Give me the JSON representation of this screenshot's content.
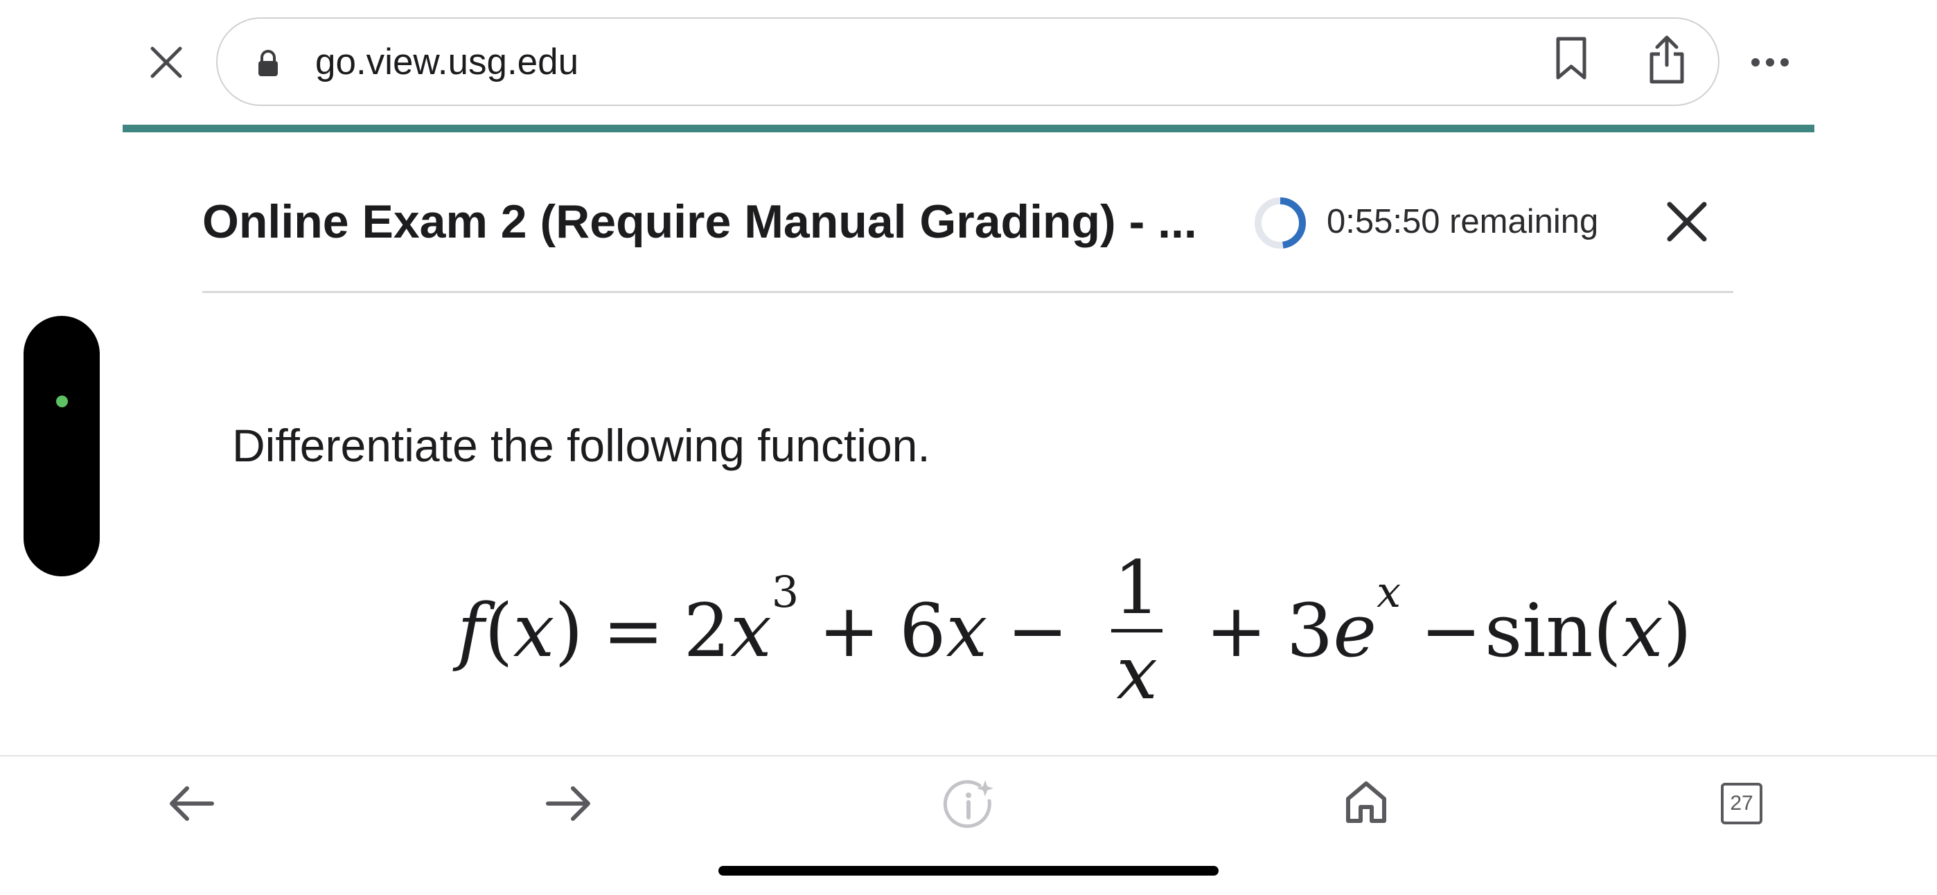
{
  "browser": {
    "url": "go.view.usg.edu",
    "icons": [
      "close-icon",
      "lock-icon",
      "bookmark-icon",
      "share-icon",
      "more-icon"
    ]
  },
  "exam": {
    "title": "Online Exam 2 (Require Manual Grading) - ...",
    "timer_text": "0:55:50 remaining",
    "timer_fraction_remaining": 0.93
  },
  "question": {
    "prompt": "Differentiate the following function.",
    "math": {
      "lhs_f": "f",
      "lhs_open": "(",
      "lhs_x": "x",
      "lhs_close": ")",
      "equals": "=",
      "t1_coef": "2",
      "t1_var": "x",
      "t1_exp": "3",
      "plus1": "+",
      "t2_coef": "6",
      "t2_var": "x",
      "minus1": "−",
      "frac_num": "1",
      "frac_den": "x",
      "plus2": "+",
      "t4_coef": "3",
      "t4_base": "e",
      "t4_exp": "x",
      "minus2": "−",
      "sin_text": "sin",
      "sin_open": "(",
      "sin_x": "x",
      "sin_close": ")"
    }
  },
  "toolbar": {
    "tab_count": "27",
    "icons": [
      "back-arrow-icon",
      "forward-arrow-icon",
      "info-sparkle-icon",
      "home-icon",
      "tabs-icon"
    ]
  },
  "colors": {
    "accent_teal": "#3f8580",
    "timer_blue": "#2f6fbd",
    "status_green": "#5dc264"
  }
}
